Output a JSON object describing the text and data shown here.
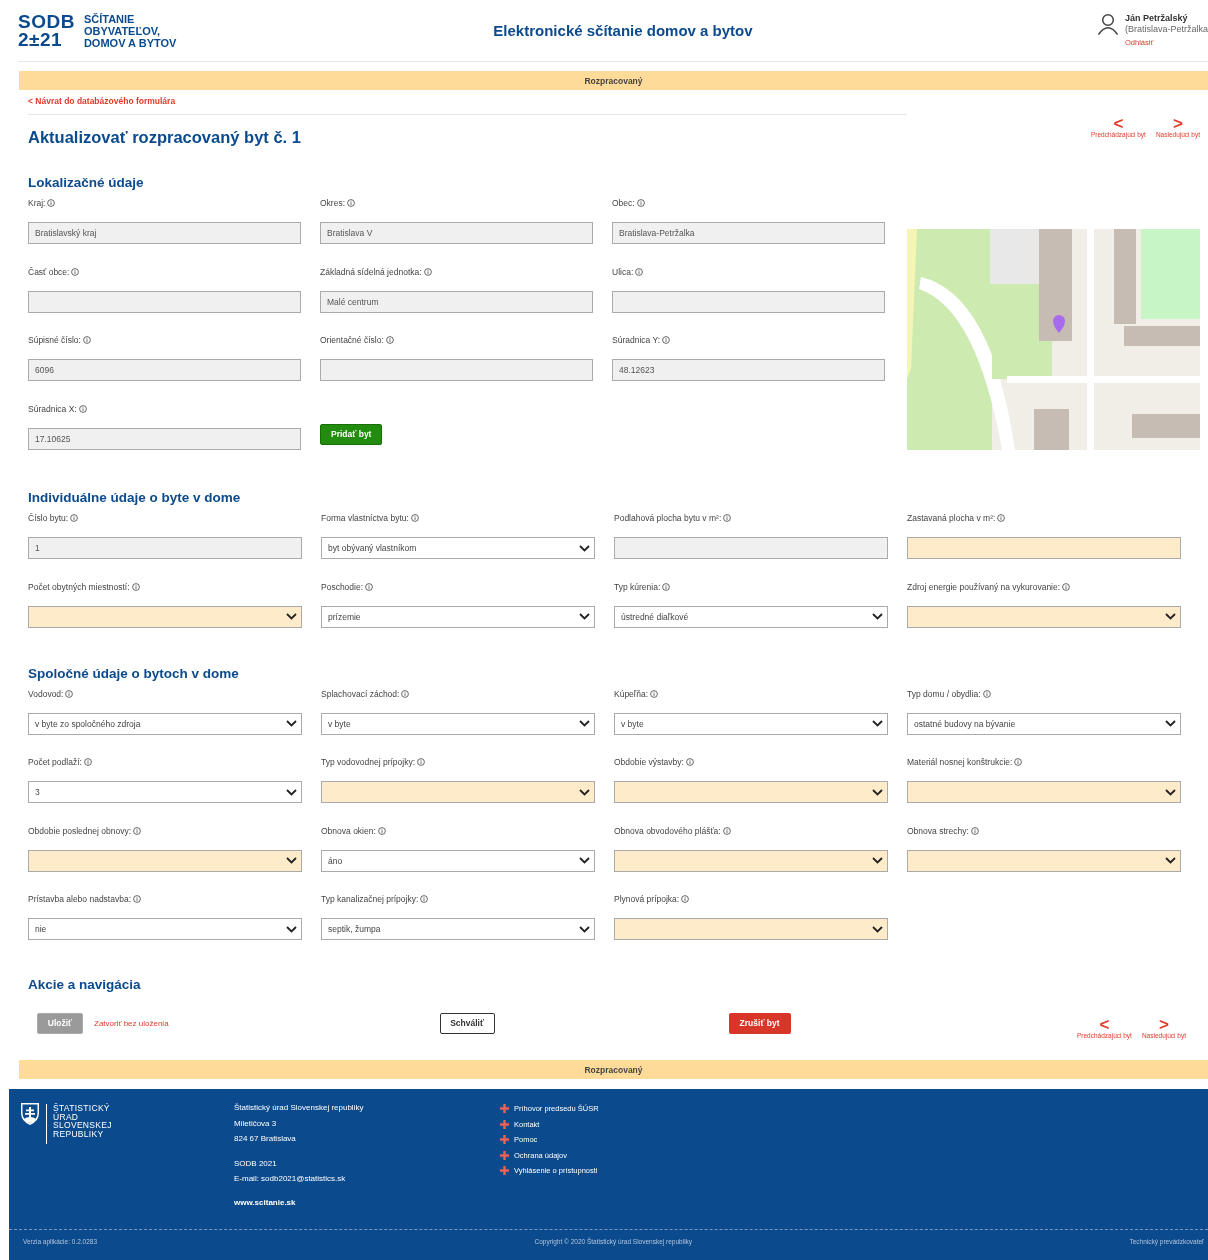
{
  "header": {
    "logo_mark": "SODB",
    "logo_year": "2±21",
    "logo_lines": [
      "SČÍTANIE",
      "OBYVATEĽOV,",
      "DOMOV A BYTOV"
    ],
    "title": "Elektronické sčítanie domov a bytov",
    "user_name": "Ján Petržalský",
    "user_region": "(Bratislava-Petržalka",
    "logout": "Odhlásiť"
  },
  "status_top": "Rozpracovaný",
  "back_link": "< Návrat do databázového formulára",
  "page_title": "Aktualizovať rozpracovaný byt č. 1",
  "top_nav": [
    {
      "arrow": "<",
      "label": "Predchádzajúci byt"
    },
    {
      "arrow": ">",
      "label": "Nasledujúci byt"
    }
  ],
  "location": {
    "title": "Lokalizačné údaje",
    "fields": [
      {
        "label": "Kraj:",
        "kind": "input",
        "value": "Bratislavský kraj",
        "disabled": true,
        "highlighted": false
      },
      {
        "label": "Okres:",
        "kind": "input",
        "value": "Bratislava V",
        "disabled": true,
        "highlighted": false
      },
      {
        "label": "Obec:",
        "kind": "input",
        "value": "Bratislava-Petržalka",
        "disabled": true,
        "highlighted": false
      },
      {
        "label": "Časť obce:",
        "kind": "input",
        "disabled": true,
        "highlighted": false
      },
      {
        "label": "Základná sídelná jednotka:",
        "kind": "input",
        "value": "Malé centrum",
        "disabled": true,
        "highlighted": false
      },
      {
        "label": "Ulica:",
        "kind": "input",
        "disabled": true,
        "highlighted": false
      },
      {
        "label": "Súpisné číslo:",
        "kind": "input",
        "value": "6096",
        "disabled": true,
        "highlighted": false
      },
      {
        "label": "Orientačné číslo:",
        "kind": "input",
        "disabled": true,
        "highlighted": false
      },
      {
        "label": "Súradnica Y:",
        "kind": "input",
        "value": "48.12623",
        "disabled": true,
        "highlighted": false
      },
      {
        "label": "Súradnica X:",
        "kind": "input",
        "value": "17.10625",
        "disabled": true,
        "highlighted": false
      }
    ],
    "add_button": "Pridať byt"
  },
  "sections": [
    {
      "title": "Individuálne údaje o byte v dome",
      "fields": [
        {
          "label": "Číslo bytu:",
          "kind": "input",
          "value": "1",
          "disabled": true,
          "highlighted": false
        },
        {
          "label": "Forma vlastníctva bytu:",
          "kind": "select",
          "value": "byt obývaný vlastníkom",
          "disabled": false,
          "highlighted": false
        },
        {
          "label": "Podlahová plocha bytu v m²:",
          "kind": "input",
          "disabled": true,
          "highlighted": false
        },
        {
          "label": "Zastavaná plocha v m²:",
          "kind": "input",
          "disabled": false,
          "highlighted": true
        },
        {
          "label": "Počet obytných miestností:",
          "kind": "select",
          "disabled": false,
          "highlighted": true
        },
        {
          "label": "Poschodie:",
          "kind": "select",
          "value": "prízemie",
          "disabled": false,
          "highlighted": false
        },
        {
          "label": "Typ kúrenia:",
          "kind": "select",
          "value": "ústredné diaľkové",
          "disabled": false,
          "highlighted": false
        },
        {
          "label": "Zdroj energie používaný na vykurovanie:",
          "kind": "select",
          "disabled": false,
          "highlighted": true
        }
      ]
    },
    {
      "title": "Spoločné údaje o bytoch v dome",
      "fields": [
        {
          "label": "Vodovod:",
          "kind": "select",
          "value": "v byte zo spoločného zdroja",
          "disabled": false,
          "highlighted": false
        },
        {
          "label": "Splachovací záchod:",
          "kind": "select",
          "value": "v byte",
          "disabled": false,
          "highlighted": false
        },
        {
          "label": "Kúpeľňa:",
          "kind": "select",
          "value": "v byte",
          "disabled": false,
          "highlighted": false
        },
        {
          "label": "Typ domu / obydlia:",
          "kind": "select",
          "value": "ostatné budovy na bývanie",
          "disabled": false,
          "highlighted": false
        },
        {
          "label": "Počet podlaží:",
          "kind": "select",
          "value": "3",
          "disabled": false,
          "highlighted": false
        },
        {
          "label": "Typ vodovodnej prípojky:",
          "kind": "select",
          "disabled": false,
          "highlighted": true
        },
        {
          "label": "Obdobie výstavby:",
          "kind": "select",
          "disabled": false,
          "highlighted": true
        },
        {
          "label": "Materiál nosnej konštrukcie:",
          "kind": "select",
          "disabled": false,
          "highlighted": true
        },
        {
          "label": "Obdobie poslednej obnovy:",
          "kind": "select",
          "disabled": false,
          "highlighted": true
        },
        {
          "label": "Obnova okien:",
          "kind": "select",
          "value": "áno",
          "disabled": false,
          "highlighted": false
        },
        {
          "label": "Obnova obvodového plášťa:",
          "kind": "select",
          "disabled": false,
          "highlighted": true
        },
        {
          "label": "Obnova strechy:",
          "kind": "select",
          "disabled": false,
          "highlighted": true
        },
        {
          "label": "Prístavba alebo nadstavba:",
          "kind": "select",
          "value": "nie",
          "disabled": false,
          "highlighted": false
        },
        {
          "label": "Typ kanalizačnej prípojky:",
          "kind": "select",
          "value": "septik, žumpa",
          "disabled": false,
          "highlighted": false
        },
        {
          "label": "Plynová prípojka:",
          "kind": "select",
          "disabled": false,
          "highlighted": true
        }
      ]
    }
  ],
  "actions": {
    "title": "Akcie a navigácia",
    "save": {
      "label": "Uložiť",
      "disabled": true
    },
    "close_link": "Zatvoriť bez uloženia",
    "approve": "Schváliť",
    "cancel": "Zrušiť byt",
    "nav": [
      {
        "arrow": "<",
        "label": "Predchádzajúci byt"
      },
      {
        "arrow": ">",
        "label": "Nasledujúci byt"
      }
    ]
  },
  "status_bottom": "Rozpracovaný",
  "footer": {
    "org_lines": [
      "ŠTATISTICKÝ",
      "ÚRAD",
      "SLOVENSKEJ",
      "REPUBLIKY"
    ],
    "address": [
      "Štatistický úrad Slovenskej republiky",
      "Miletičova 3",
      "824 67 Bratislava"
    ],
    "contact": [
      "SODB 2021",
      "E-mail: sodb2021@statistics.sk"
    ],
    "website": "www.scitanie.sk",
    "links": [
      "Príhovor predsedu ŠÚSR",
      "Kontakt",
      "Pomoc",
      "Ochrana údajov",
      "Vyhlásenie o prístupnosti"
    ],
    "version": "Verzia aplikácie: 0.2.0283",
    "copyright": "Copyright © 2020 Štatistický úrad Slovenskej republiky",
    "operator": "Technický prevádzkovateľ"
  }
}
